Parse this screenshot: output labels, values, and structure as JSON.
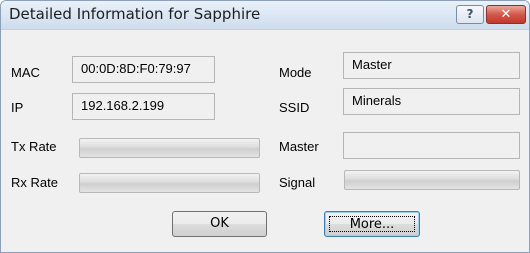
{
  "window": {
    "title": "Detailed Information for Sapphire",
    "help_glyph": "?",
    "close_glyph": "✕",
    "help_icon": "question-mark",
    "close_icon": "x-mark",
    "close_color": "#c7402f"
  },
  "fields": {
    "mac": {
      "label": "MAC",
      "value": "00:0D:8D:F0:79:97"
    },
    "ip": {
      "label": "IP",
      "value": "192.168.2.199"
    },
    "tx_rate": {
      "label": "Tx Rate",
      "level": 0
    },
    "rx_rate": {
      "label": "Rx Rate",
      "level": 0
    },
    "mode": {
      "label": "Mode",
      "value": "Master"
    },
    "ssid": {
      "label": "SSID",
      "value": "Minerals"
    },
    "master": {
      "label": "Master",
      "value": ""
    },
    "signal": {
      "label": "Signal",
      "level": 0
    }
  },
  "buttons": {
    "ok": "OK",
    "more": "More..."
  }
}
